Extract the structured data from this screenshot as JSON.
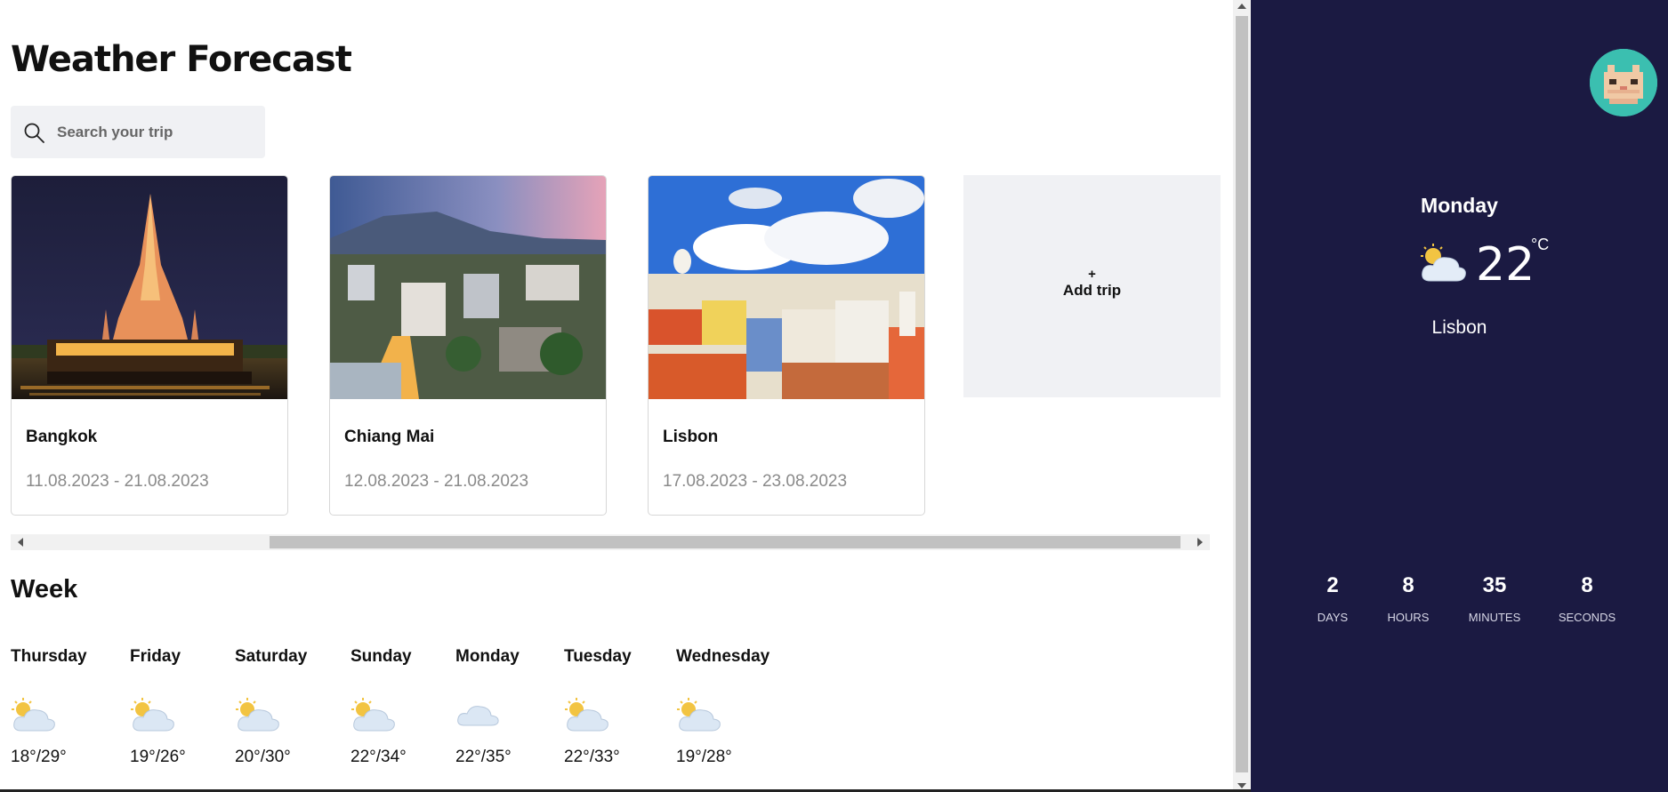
{
  "header": {
    "title_light": "Weather",
    "title_bold": "Forecast"
  },
  "search": {
    "placeholder": "Search your trip",
    "icon": "search-icon"
  },
  "trips": [
    {
      "city": "Bangkok",
      "dates": "11.08.2023 - 21.08.2023",
      "image": "bangkok-temple-night"
    },
    {
      "city": "Chiang Mai",
      "dates": "12.08.2023 - 21.08.2023",
      "image": "chiang-mai-city-dusk"
    },
    {
      "city": "Lisbon",
      "dates": "17.08.2023 - 23.08.2023",
      "image": "lisbon-rooftops"
    }
  ],
  "add_trip": {
    "plus": "+",
    "label": "Add trip"
  },
  "week": {
    "title": "Week",
    "days": [
      {
        "name": "Thursday",
        "temps": "18°/29°",
        "icon": "partly-cloudy-icon"
      },
      {
        "name": "Friday",
        "temps": "19°/26°",
        "icon": "partly-cloudy-icon"
      },
      {
        "name": "Saturday",
        "temps": "20°/30°",
        "icon": "partly-cloudy-icon"
      },
      {
        "name": "Sunday",
        "temps": "22°/34°",
        "icon": "partly-cloudy-icon"
      },
      {
        "name": "Monday",
        "temps": "22°/35°",
        "icon": "cloudy-icon"
      },
      {
        "name": "Tuesday",
        "temps": "22°/33°",
        "icon": "partly-cloudy-icon"
      },
      {
        "name": "Wednesday",
        "temps": "19°/28°",
        "icon": "partly-cloudy-icon"
      }
    ]
  },
  "panel": {
    "day": "Monday",
    "temp": "22",
    "unit": "°C",
    "city": "Lisbon",
    "icon": "partly-cloudy-icon",
    "avatar": "cat-avatar",
    "countdown": [
      {
        "value": "2",
        "label": "DAYS"
      },
      {
        "value": "8",
        "label": "HOURS"
      },
      {
        "value": "35",
        "label": "MINUTES"
      },
      {
        "value": "8",
        "label": "SECONDS"
      }
    ]
  },
  "colors": {
    "panel_bg": "#1b1a42",
    "avatar_bg": "#3bbfb0",
    "search_bg": "#f0f1f4",
    "date_text": "#8a8a8a"
  }
}
